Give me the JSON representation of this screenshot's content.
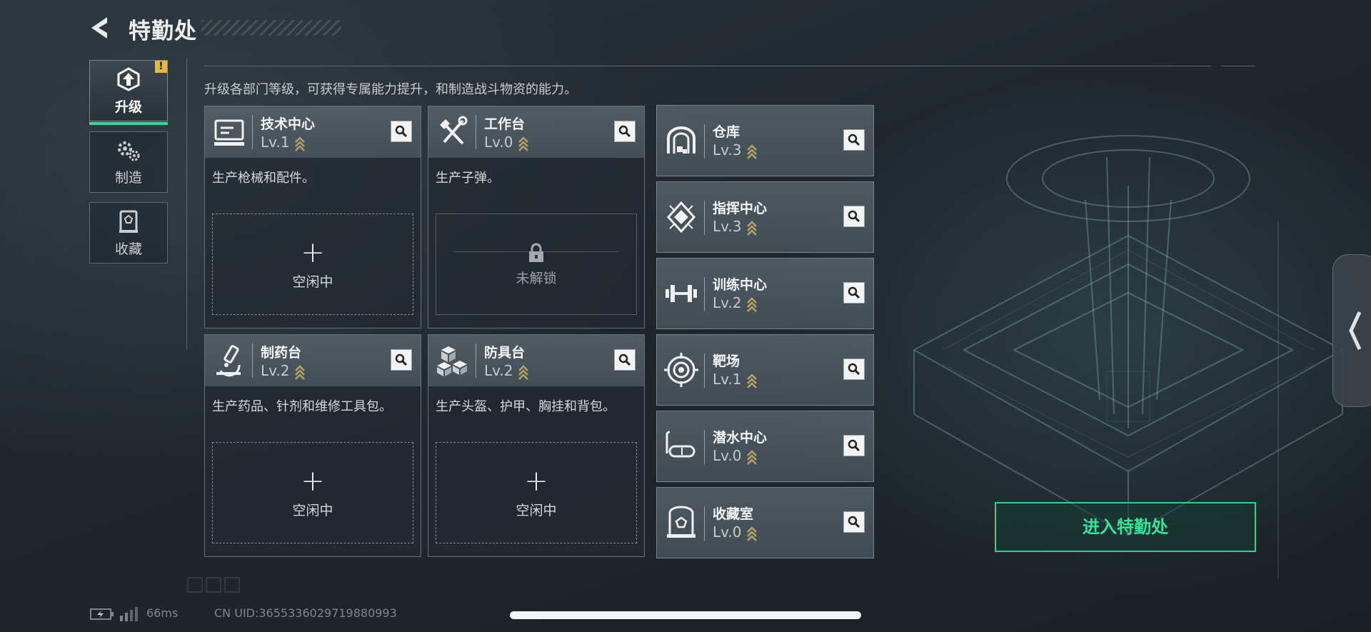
{
  "header": {
    "title": "特勤处"
  },
  "tabs": [
    {
      "label": "升级",
      "active": true,
      "alert": "!"
    },
    {
      "label": "制造",
      "active": false
    },
    {
      "label": "收藏",
      "active": false
    }
  ],
  "subtitle": "升级各部门等级，可获得专属能力提升，和制造战斗物资的能力。",
  "facilities": [
    {
      "name": "技术中心",
      "level": "Lv.1",
      "desc": "生产枪械和配件。",
      "slot": {
        "plus": "+",
        "label": "空闲中",
        "locked": false
      }
    },
    {
      "name": "工作台",
      "level": "Lv.0",
      "desc": "生产子弹。",
      "slot": {
        "plus": "",
        "label": "未解锁",
        "locked": true
      }
    },
    {
      "name": "制药台",
      "level": "Lv.2",
      "desc": "生产药品、针剂和维修工具包。",
      "slot": {
        "plus": "+",
        "label": "空闲中",
        "locked": false
      }
    },
    {
      "name": "防具台",
      "level": "Lv.2",
      "desc": "生产头盔、护甲、胸挂和背包。",
      "slot": {
        "plus": "+",
        "label": "空闲中",
        "locked": false
      }
    }
  ],
  "small_facilities": [
    {
      "name": "仓库",
      "level": "Lv.3"
    },
    {
      "name": "指挥中心",
      "level": "Lv.3"
    },
    {
      "name": "训练中心",
      "level": "Lv.2"
    },
    {
      "name": "靶场",
      "level": "Lv.1"
    },
    {
      "name": "潜水中心",
      "level": "Lv.0"
    },
    {
      "name": "收藏室",
      "level": "Lv.0"
    }
  ],
  "enter_button": "进入特勤处",
  "footer": {
    "ping": "66ms",
    "uid": "CN UID:3655336029719880993"
  },
  "colors": {
    "accent": "#36e49c",
    "alert": "#e5b83b",
    "level_arrows": "#b4a36a"
  }
}
